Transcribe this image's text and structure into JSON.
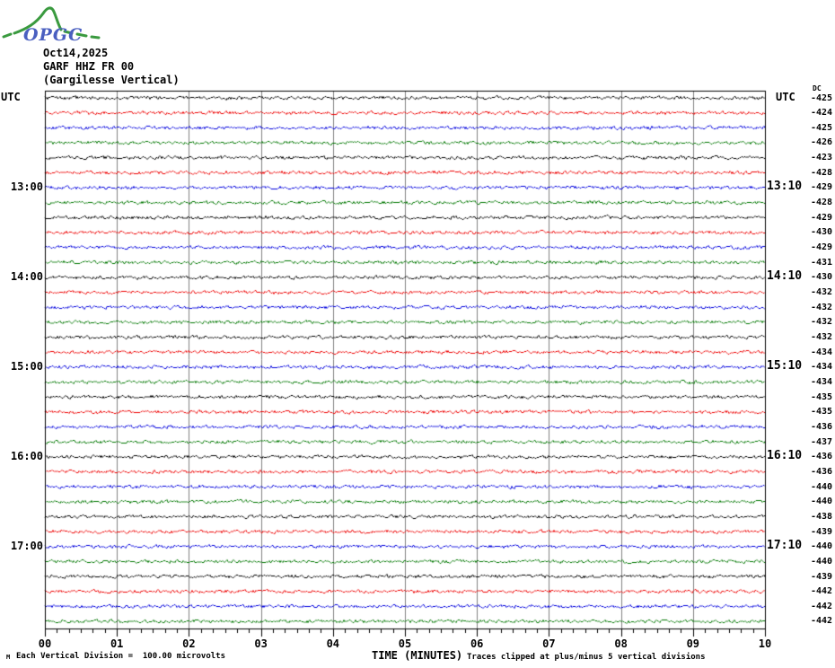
{
  "logo": {
    "text": "OPGC",
    "curve_color": "#3a9a3f",
    "text_color": "#4a5fc0"
  },
  "header": {
    "date": "Oct14,2025",
    "station": "GARF HHZ FR 00",
    "station_description": "(Gargilesse Vertical)"
  },
  "axes": {
    "utc_left": "UTC",
    "utc_right": "UTC",
    "dc_header": "DC",
    "x_axis_title": "TIME (MINUTES)"
  },
  "footer": {
    "corner_mark": "M",
    "scale_note": "Each Vertical Division =  100.00 microvolts",
    "clip_note": "Traces clipped at plus/minus 5 vertical divisions"
  },
  "chart_data": {
    "type": "line",
    "subtype": "helicorder-seismogram",
    "title": "GARF HHZ FR 00 (Gargilesse Vertical) — Oct14,2025",
    "timezone": "UTC",
    "xlabel": "TIME (MINUTES)",
    "x_range_minutes": [
      0,
      10
    ],
    "x_tick_labels": [
      "00",
      "01",
      "02",
      "03",
      "04",
      "05",
      "06",
      "07",
      "08",
      "09",
      "10"
    ],
    "minor_ticks_per_minute": 6,
    "minutes_per_trace": 10,
    "n_traces": 36,
    "trace_color_cycle": [
      "#000000",
      "#ee0000",
      "#0000dd",
      "#007700"
    ],
    "grid_color": "#808080",
    "left_hour_labels": [
      {
        "row": 7,
        "label": "13:00"
      },
      {
        "row": 13,
        "label": "14:00"
      },
      {
        "row": 19,
        "label": "15:00"
      },
      {
        "row": 25,
        "label": "16:00"
      },
      {
        "row": 31,
        "label": "17:00"
      }
    ],
    "right_end_labels": [
      {
        "row": 7,
        "label": "13:10"
      },
      {
        "row": 13,
        "label": "14:10"
      },
      {
        "row": 19,
        "label": "15:10"
      },
      {
        "row": 25,
        "label": "16:10"
      },
      {
        "row": 31,
        "label": "17:10"
      }
    ],
    "dc_offsets": [
      -425,
      -424,
      -425,
      -426,
      -423,
      -428,
      -429,
      -428,
      -429,
      -430,
      -429,
      -431,
      -430,
      -432,
      -432,
      -432,
      -432,
      -434,
      -434,
      -434,
      -435,
      -435,
      -436,
      -437,
      -436,
      -436,
      -440,
      -440,
      -438,
      -439,
      -440,
      -440,
      -439,
      -442,
      -442,
      -442
    ],
    "vertical_division_microvolts": 100.0,
    "clip_limit_divisions": 5,
    "signal_description": "continuous low-amplitude background noise; no visible seismic events"
  }
}
